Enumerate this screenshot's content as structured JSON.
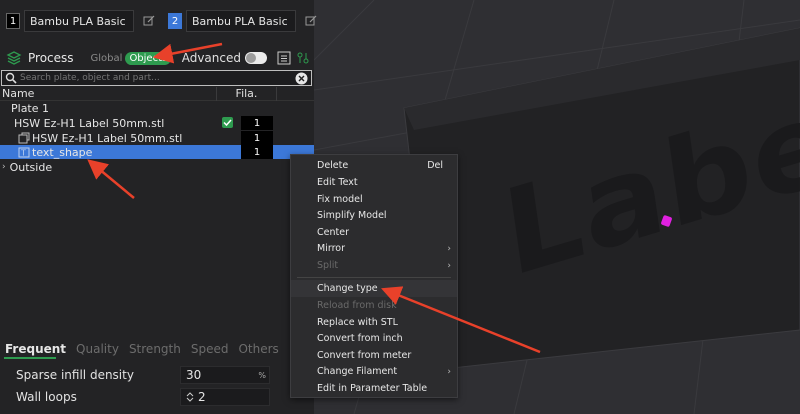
{
  "filaments": [
    {
      "number": "1",
      "name": "Bambu PLA Basic",
      "color": "#000000"
    },
    {
      "number": "2",
      "name": "Bambu PLA Basic",
      "color": "#3c78d8"
    }
  ],
  "process": {
    "label": "Process",
    "global_label": "Global",
    "objects_label": "Objects",
    "advanced_label": "Advanced"
  },
  "search": {
    "placeholder": "Search plate, object and part..."
  },
  "tree": {
    "header_name": "Name",
    "header_fila": "Fila.",
    "rows": [
      {
        "label": "Plate 1"
      },
      {
        "label": "HSW Ez-H1 Label 50mm.stl",
        "fila": "1"
      },
      {
        "label": "HSW Ez-H1 Label 50mm.stl",
        "fila": "1"
      },
      {
        "label": "text_shape",
        "fila": "1"
      },
      {
        "label": "Outside"
      }
    ]
  },
  "settings": {
    "tabs": [
      "Frequent",
      "Quality",
      "Strength",
      "Speed",
      "Others"
    ],
    "items": [
      {
        "label": "Sparse infill density",
        "value": "30",
        "unit": "%"
      },
      {
        "label": "Wall loops",
        "value": "2"
      }
    ]
  },
  "context_menu": {
    "items": [
      {
        "label": "Delete",
        "shortcut": "Del"
      },
      {
        "label": "Edit Text"
      },
      {
        "label": "Fix model"
      },
      {
        "label": "Simplify Model"
      },
      {
        "label": "Center"
      },
      {
        "label": "Mirror",
        "submenu": "›"
      },
      {
        "label": "Split",
        "submenu": "›"
      },
      {
        "label": "Change type"
      },
      {
        "label": "Reload from disk"
      },
      {
        "label": "Replace with STL"
      },
      {
        "label": "Convert from inch"
      },
      {
        "label": "Convert from meter"
      },
      {
        "label": "Change Filament",
        "submenu": "›"
      },
      {
        "label": "Edit in Parameter Table"
      }
    ]
  },
  "viewport": {
    "model_text": "Labe"
  },
  "colors": {
    "accent_green": "#2e9b4f",
    "selection_blue": "#3c78d8",
    "annotation_red": "#e8412a",
    "marker_magenta": "#e020e0"
  }
}
